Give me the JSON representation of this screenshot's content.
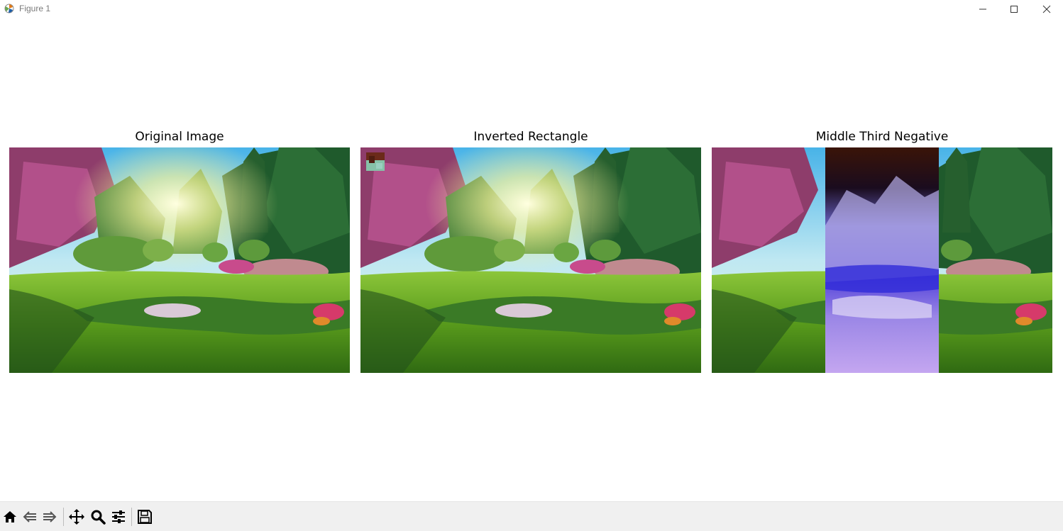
{
  "window": {
    "title": "Figure 1",
    "icons": [
      "matplotlib-icon",
      "minimize-icon",
      "maximize-icon",
      "close-icon"
    ]
  },
  "figure": {
    "panels": [
      {
        "title": "Original Image",
        "image": "garden-photo"
      },
      {
        "title": "Inverted Rectangle",
        "image": "garden-photo-with-inverted-top-left-rectangle"
      },
      {
        "title": "Middle Third Negative",
        "image": "garden-photo-with-middle-third-negative"
      }
    ]
  },
  "toolbar": {
    "buttons": [
      "home-icon",
      "back-icon",
      "forward-icon",
      "pan-icon",
      "zoom-icon",
      "configure-subplots-icon",
      "save-icon"
    ]
  },
  "colors": {
    "toolbar_bg": "#f0f0f0",
    "sky": "#4fb7e6",
    "grass": "#4f9a1c",
    "foliage": "#2e6b2f",
    "negative_purple": "#8a7ae8"
  }
}
